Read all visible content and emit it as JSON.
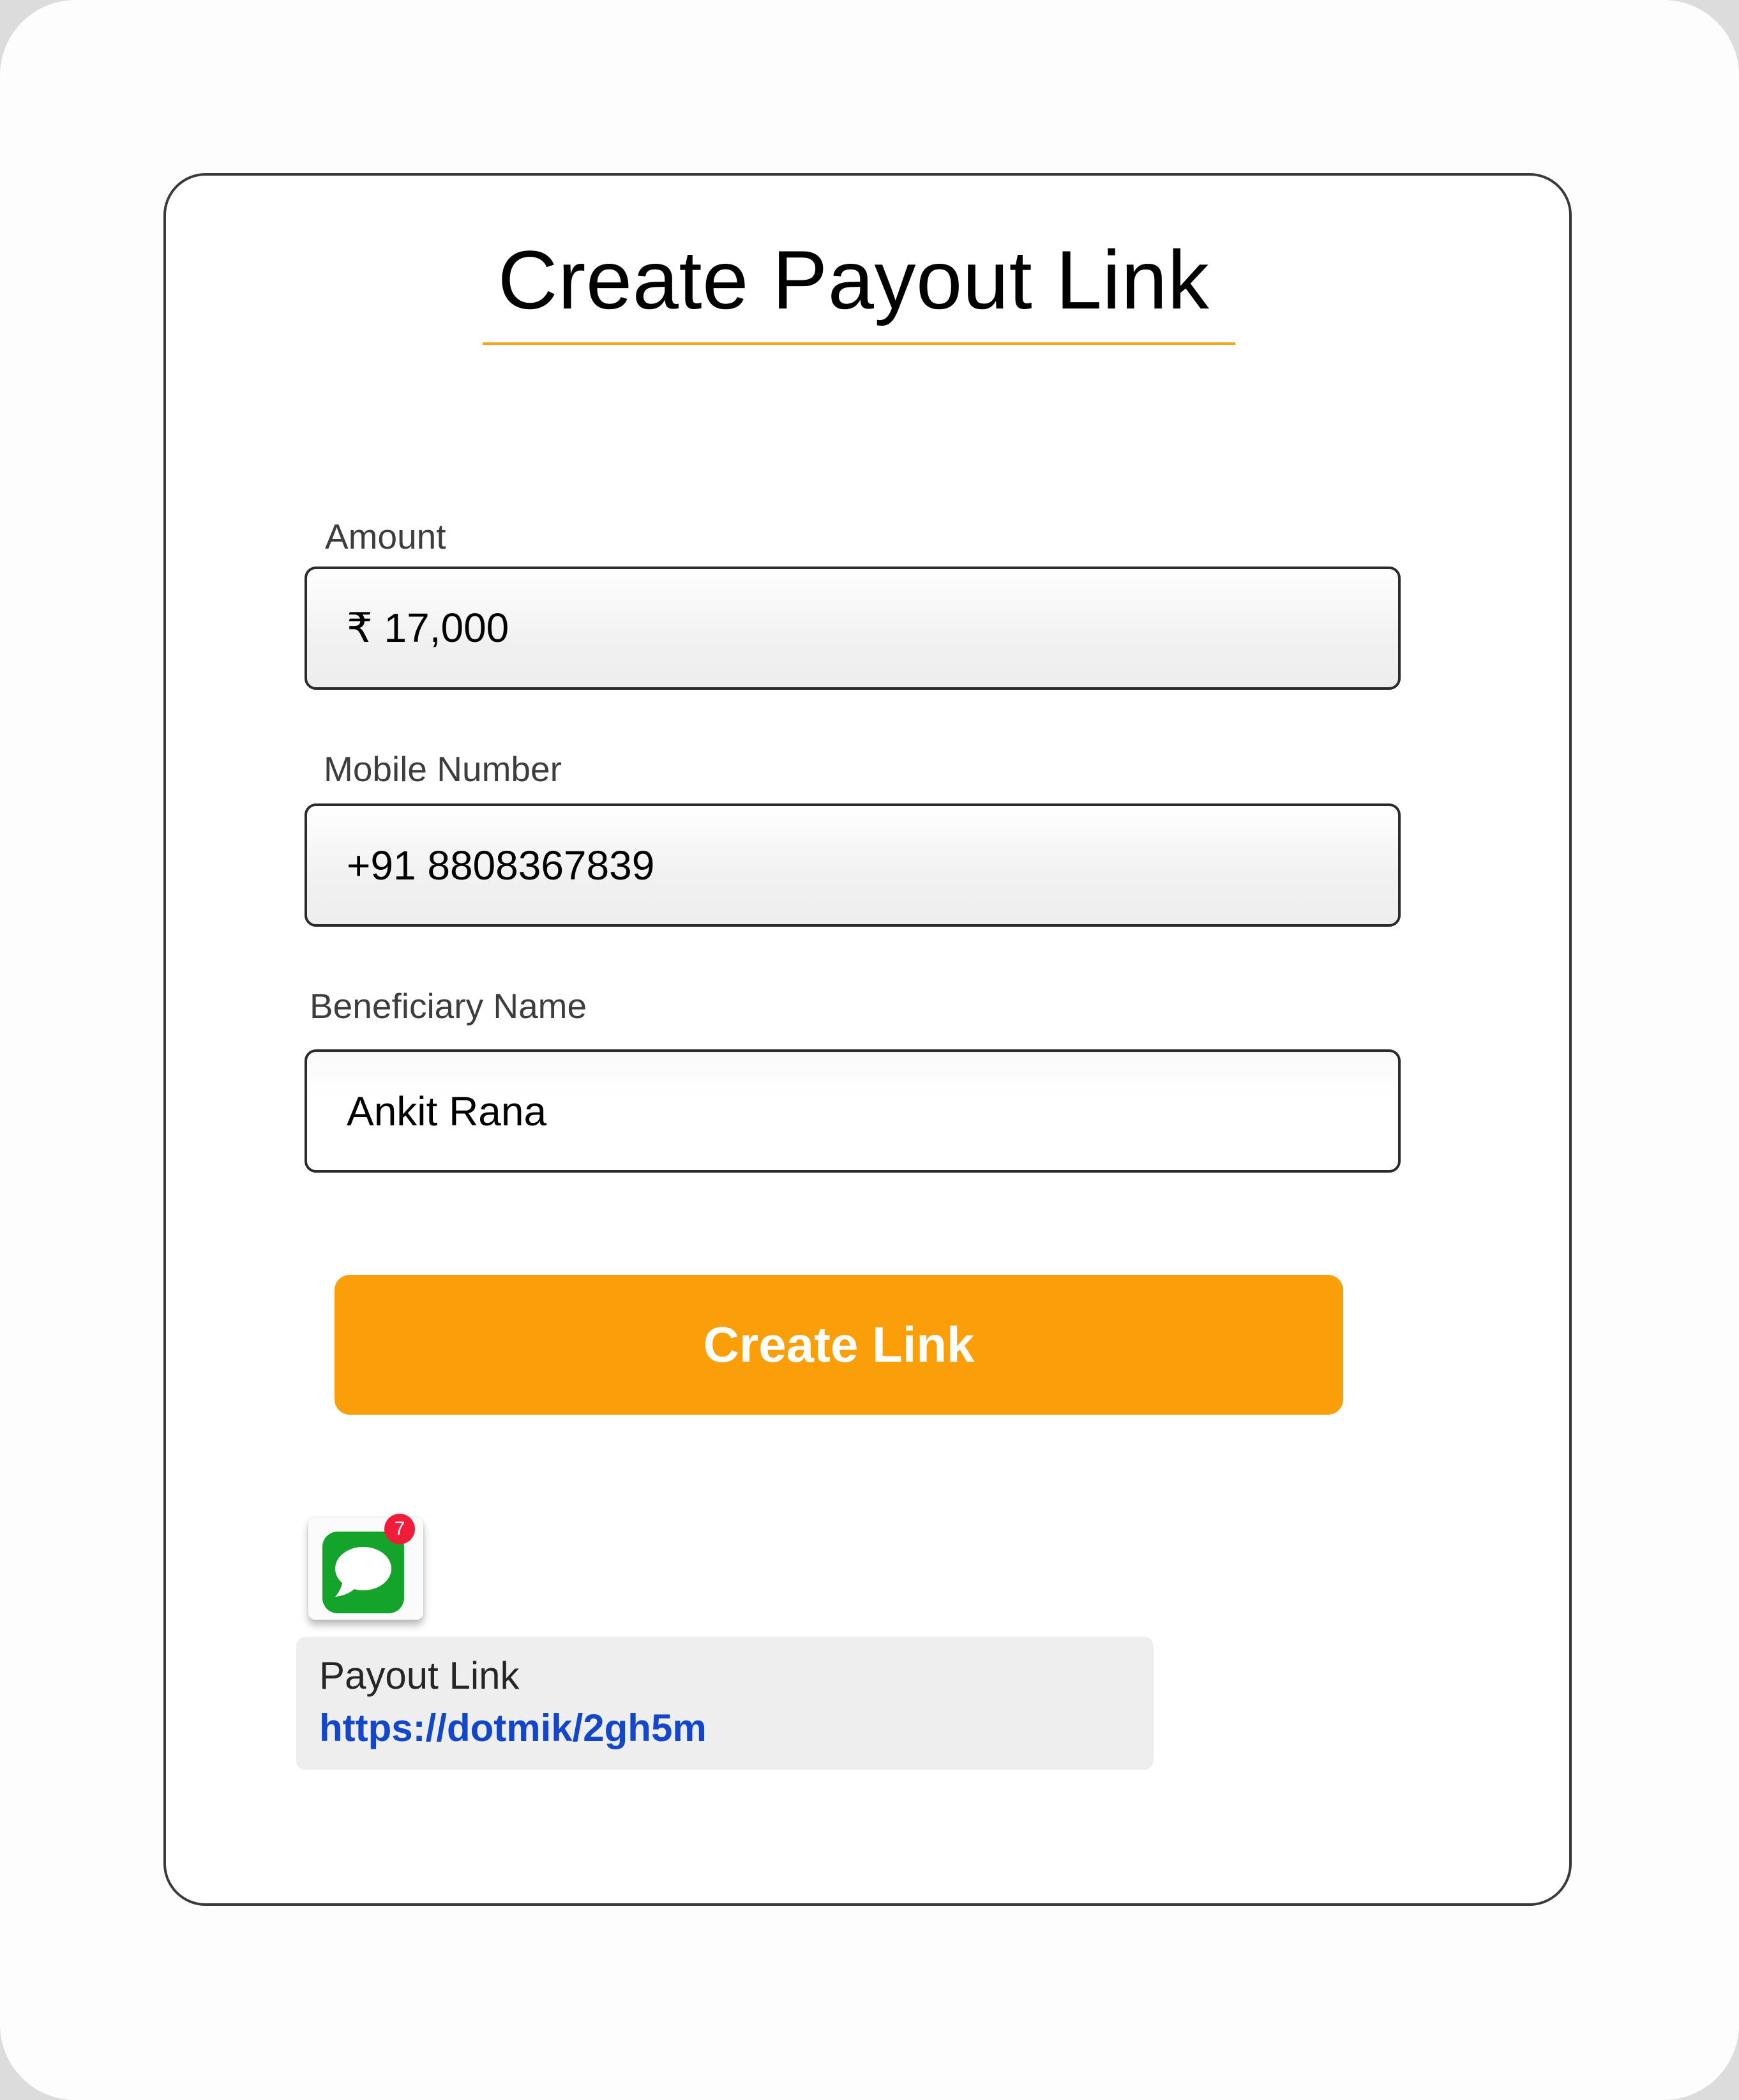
{
  "form": {
    "title": "Create Payout Link",
    "amount": {
      "label": "Amount",
      "value": "₹ 17,000"
    },
    "mobile": {
      "label": "Mobile Number",
      "value": "+91 8808367839"
    },
    "beneficiary": {
      "label": "Beneficiary Name",
      "value": "Ankit Rana"
    },
    "submit_label": "Create Link"
  },
  "notification": {
    "app_icon": "messages-icon",
    "badge_count": "7",
    "title": "Payout Link",
    "link": "https://dotmik/2gh5m"
  },
  "colors": {
    "accent": "#fa9f0a",
    "link": "#1347c9",
    "badge": "#ef1c3a",
    "messages_green": "#14a32b"
  }
}
